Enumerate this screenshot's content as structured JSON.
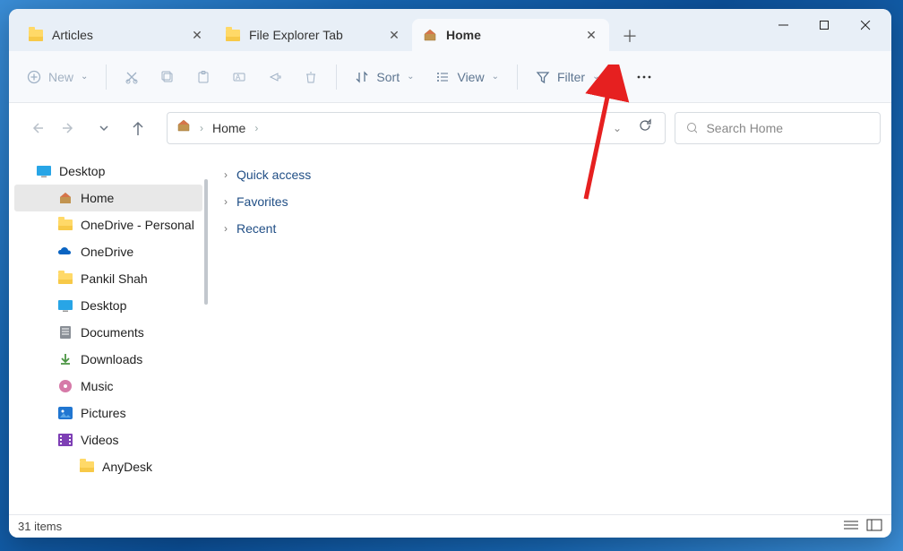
{
  "tabs": [
    {
      "label": "Articles",
      "type": "folder",
      "active": false
    },
    {
      "label": "File Explorer Tab",
      "type": "folder",
      "active": false
    },
    {
      "label": "Home",
      "type": "home",
      "active": true
    }
  ],
  "toolbar": {
    "new_label": "New",
    "sort_label": "Sort",
    "view_label": "View",
    "filter_label": "Filter"
  },
  "breadcrumb": {
    "current": "Home"
  },
  "search": {
    "placeholder": "Search Home"
  },
  "sidebar": {
    "items": [
      {
        "label": "Desktop",
        "icon": "desktop-blue",
        "sub": false
      },
      {
        "label": "Home",
        "icon": "home",
        "sub": true,
        "selected": true
      },
      {
        "label": "OneDrive - Personal",
        "icon": "folder",
        "sub": true
      },
      {
        "label": "OneDrive",
        "icon": "onedrive",
        "sub": true
      },
      {
        "label": "Pankil Shah",
        "icon": "folder",
        "sub": true
      },
      {
        "label": "Desktop",
        "icon": "desktop-blue",
        "sub": true
      },
      {
        "label": "Documents",
        "icon": "documents",
        "sub": true
      },
      {
        "label": "Downloads",
        "icon": "downloads",
        "sub": true
      },
      {
        "label": "Music",
        "icon": "music",
        "sub": true
      },
      {
        "label": "Pictures",
        "icon": "pictures",
        "sub": true
      },
      {
        "label": "Videos",
        "icon": "videos",
        "sub": true
      },
      {
        "label": "AnyDesk",
        "icon": "folder",
        "sub": true,
        "subsub": true
      }
    ]
  },
  "content": {
    "groups": [
      {
        "label": "Quick access"
      },
      {
        "label": "Favorites"
      },
      {
        "label": "Recent"
      }
    ]
  },
  "status": {
    "items_count": "31 items"
  }
}
